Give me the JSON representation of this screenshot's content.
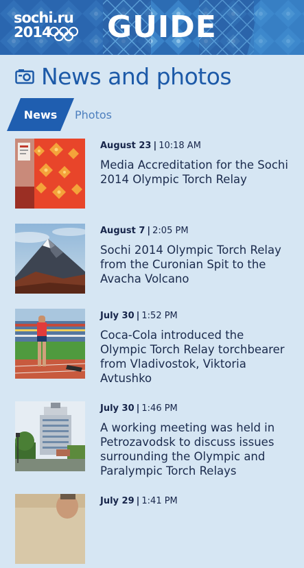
{
  "header": {
    "logo_line1": "sochi.ru",
    "logo_line2": "2014",
    "title": "GUIDE"
  },
  "page": {
    "title": "News and photos"
  },
  "tabs": [
    {
      "label": "News",
      "selected": true
    },
    {
      "label": "Photos",
      "selected": false
    }
  ],
  "news": [
    {
      "date": "August 23",
      "time": "10:18 AM",
      "headline": "Media Accreditation for the Sochi 2014 Olympic Torch Relay",
      "thumb": "torch-ornament"
    },
    {
      "date": "August 7",
      "time": "2:05 PM",
      "headline": "Sochi 2014 Olympic Torch Relay from the Curonian Spit to the Avacha Volcano",
      "thumb": "volcano"
    },
    {
      "date": "July 30",
      "time": "1:52 PM",
      "headline": "Coca-Cola introduced the Olympic Torch Relay torchbearer from Vladivostok, Viktoria Avtushko",
      "thumb": "stadium-athlete"
    },
    {
      "date": "July 30",
      "time": "1:46 PM",
      "headline": "A working meeting was held in Petrozavodsk to discuss issues surrounding the Olympic and Paralympic Torch Relays",
      "thumb": "building"
    },
    {
      "date": "July 29",
      "time": "1:41 PM",
      "headline": "",
      "thumb": "portrait"
    }
  ],
  "colors": {
    "background": "#d6e6f3",
    "accent": "#1d5aa8",
    "banner": "#2d6fb6"
  }
}
